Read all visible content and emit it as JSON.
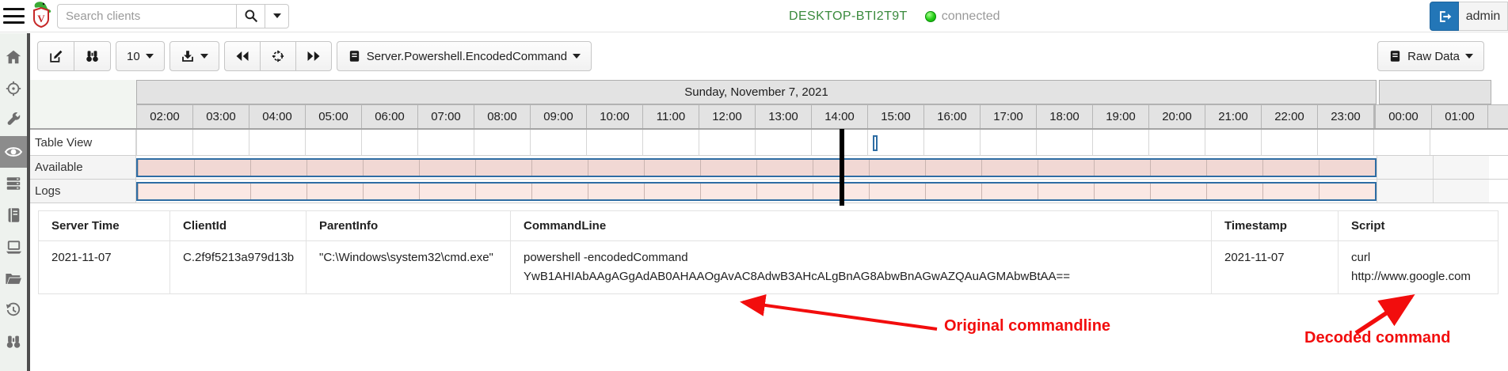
{
  "topbar": {
    "search_placeholder": "Search clients",
    "hostname": "DESKTOP-BTI2T9T",
    "status_label": "connected",
    "user_label": "admin",
    "colors": {
      "hostname_green": "#3a8a3d",
      "status_gray": "#9a9a9a",
      "logout_blue": "#2376b7"
    }
  },
  "sidebar": {
    "active_item": "eye",
    "icons": [
      "home",
      "crosshair",
      "wrench",
      "eye",
      "server-stack",
      "notebook",
      "laptop",
      "folder-open",
      "history",
      "binoculars"
    ]
  },
  "toolbar": {
    "page_size": "10",
    "artifact_name": "Server.Powershell.EncodedCommand",
    "raw_data_label": "Raw Data"
  },
  "timeline": {
    "date_label": "Sunday, November 7, 2021",
    "hours_day1": [
      "02:00",
      "03:00",
      "04:00",
      "05:00",
      "06:00",
      "07:00",
      "08:00",
      "09:00",
      "10:00",
      "11:00",
      "12:00",
      "13:00",
      "14:00",
      "15:00",
      "16:00",
      "17:00",
      "18:00",
      "19:00",
      "20:00",
      "21:00",
      "22:00",
      "23:00"
    ],
    "hours_day2": [
      "00:00",
      "01:00"
    ],
    "rows": [
      "Table View",
      "Available",
      "Logs"
    ],
    "colors": {
      "available_pink": "#f1d8d4",
      "logs_pink": "#fbe8e4",
      "bar_border_blue": "#2e6da4",
      "playhead_black": "#000000"
    }
  },
  "table": {
    "columns": [
      "Server Time",
      "ClientId",
      "ParentInfo",
      "CommandLine",
      "Timestamp",
      "Script"
    ],
    "rows": [
      {
        "server_time": "2021-11-07",
        "client_id": "C.2f9f5213a979d13b",
        "parent_info": "\"C:\\Windows\\system32\\cmd.exe\"",
        "command_line_1": "powershell -encodedCommand",
        "command_line_2": "YwB1AHIAbAAgAGgAdAB0AHAAOgAvAC8AdwB3AHcALgBnAG8AbwBnAGwAZQAuAGMAbwBtAA==",
        "timestamp": "2021-11-07",
        "script_1": "curl",
        "script_2": "http://www.google.com"
      }
    ]
  },
  "annotations": {
    "original_label": "Original commandline",
    "decoded_label": "Decoded command",
    "color": "#f20d0d"
  }
}
